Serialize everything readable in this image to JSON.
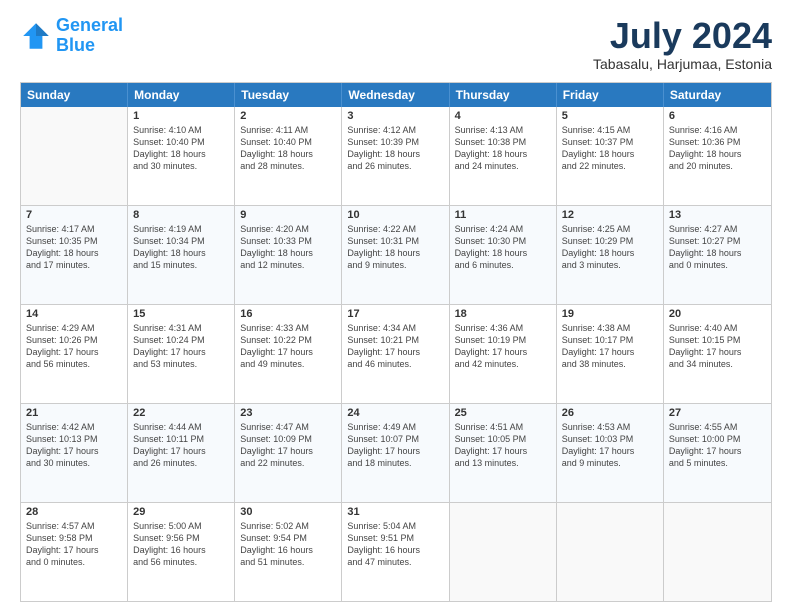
{
  "header": {
    "logo_line1": "General",
    "logo_line2": "Blue",
    "month_title": "July 2024",
    "location": "Tabasalu, Harjumaa, Estonia"
  },
  "calendar": {
    "days_of_week": [
      "Sunday",
      "Monday",
      "Tuesday",
      "Wednesday",
      "Thursday",
      "Friday",
      "Saturday"
    ],
    "rows": [
      [
        {
          "day": "",
          "info": ""
        },
        {
          "day": "1",
          "info": "Sunrise: 4:10 AM\nSunset: 10:40 PM\nDaylight: 18 hours\nand 30 minutes."
        },
        {
          "day": "2",
          "info": "Sunrise: 4:11 AM\nSunset: 10:40 PM\nDaylight: 18 hours\nand 28 minutes."
        },
        {
          "day": "3",
          "info": "Sunrise: 4:12 AM\nSunset: 10:39 PM\nDaylight: 18 hours\nand 26 minutes."
        },
        {
          "day": "4",
          "info": "Sunrise: 4:13 AM\nSunset: 10:38 PM\nDaylight: 18 hours\nand 24 minutes."
        },
        {
          "day": "5",
          "info": "Sunrise: 4:15 AM\nSunset: 10:37 PM\nDaylight: 18 hours\nand 22 minutes."
        },
        {
          "day": "6",
          "info": "Sunrise: 4:16 AM\nSunset: 10:36 PM\nDaylight: 18 hours\nand 20 minutes."
        }
      ],
      [
        {
          "day": "7",
          "info": "Sunrise: 4:17 AM\nSunset: 10:35 PM\nDaylight: 18 hours\nand 17 minutes."
        },
        {
          "day": "8",
          "info": "Sunrise: 4:19 AM\nSunset: 10:34 PM\nDaylight: 18 hours\nand 15 minutes."
        },
        {
          "day": "9",
          "info": "Sunrise: 4:20 AM\nSunset: 10:33 PM\nDaylight: 18 hours\nand 12 minutes."
        },
        {
          "day": "10",
          "info": "Sunrise: 4:22 AM\nSunset: 10:31 PM\nDaylight: 18 hours\nand 9 minutes."
        },
        {
          "day": "11",
          "info": "Sunrise: 4:24 AM\nSunset: 10:30 PM\nDaylight: 18 hours\nand 6 minutes."
        },
        {
          "day": "12",
          "info": "Sunrise: 4:25 AM\nSunset: 10:29 PM\nDaylight: 18 hours\nand 3 minutes."
        },
        {
          "day": "13",
          "info": "Sunrise: 4:27 AM\nSunset: 10:27 PM\nDaylight: 18 hours\nand 0 minutes."
        }
      ],
      [
        {
          "day": "14",
          "info": "Sunrise: 4:29 AM\nSunset: 10:26 PM\nDaylight: 17 hours\nand 56 minutes."
        },
        {
          "day": "15",
          "info": "Sunrise: 4:31 AM\nSunset: 10:24 PM\nDaylight: 17 hours\nand 53 minutes."
        },
        {
          "day": "16",
          "info": "Sunrise: 4:33 AM\nSunset: 10:22 PM\nDaylight: 17 hours\nand 49 minutes."
        },
        {
          "day": "17",
          "info": "Sunrise: 4:34 AM\nSunset: 10:21 PM\nDaylight: 17 hours\nand 46 minutes."
        },
        {
          "day": "18",
          "info": "Sunrise: 4:36 AM\nSunset: 10:19 PM\nDaylight: 17 hours\nand 42 minutes."
        },
        {
          "day": "19",
          "info": "Sunrise: 4:38 AM\nSunset: 10:17 PM\nDaylight: 17 hours\nand 38 minutes."
        },
        {
          "day": "20",
          "info": "Sunrise: 4:40 AM\nSunset: 10:15 PM\nDaylight: 17 hours\nand 34 minutes."
        }
      ],
      [
        {
          "day": "21",
          "info": "Sunrise: 4:42 AM\nSunset: 10:13 PM\nDaylight: 17 hours\nand 30 minutes."
        },
        {
          "day": "22",
          "info": "Sunrise: 4:44 AM\nSunset: 10:11 PM\nDaylight: 17 hours\nand 26 minutes."
        },
        {
          "day": "23",
          "info": "Sunrise: 4:47 AM\nSunset: 10:09 PM\nDaylight: 17 hours\nand 22 minutes."
        },
        {
          "day": "24",
          "info": "Sunrise: 4:49 AM\nSunset: 10:07 PM\nDaylight: 17 hours\nand 18 minutes."
        },
        {
          "day": "25",
          "info": "Sunrise: 4:51 AM\nSunset: 10:05 PM\nDaylight: 17 hours\nand 13 minutes."
        },
        {
          "day": "26",
          "info": "Sunrise: 4:53 AM\nSunset: 10:03 PM\nDaylight: 17 hours\nand 9 minutes."
        },
        {
          "day": "27",
          "info": "Sunrise: 4:55 AM\nSunset: 10:00 PM\nDaylight: 17 hours\nand 5 minutes."
        }
      ],
      [
        {
          "day": "28",
          "info": "Sunrise: 4:57 AM\nSunset: 9:58 PM\nDaylight: 17 hours\nand 0 minutes."
        },
        {
          "day": "29",
          "info": "Sunrise: 5:00 AM\nSunset: 9:56 PM\nDaylight: 16 hours\nand 56 minutes."
        },
        {
          "day": "30",
          "info": "Sunrise: 5:02 AM\nSunset: 9:54 PM\nDaylight: 16 hours\nand 51 minutes."
        },
        {
          "day": "31",
          "info": "Sunrise: 5:04 AM\nSunset: 9:51 PM\nDaylight: 16 hours\nand 47 minutes."
        },
        {
          "day": "",
          "info": ""
        },
        {
          "day": "",
          "info": ""
        },
        {
          "day": "",
          "info": ""
        }
      ]
    ]
  }
}
